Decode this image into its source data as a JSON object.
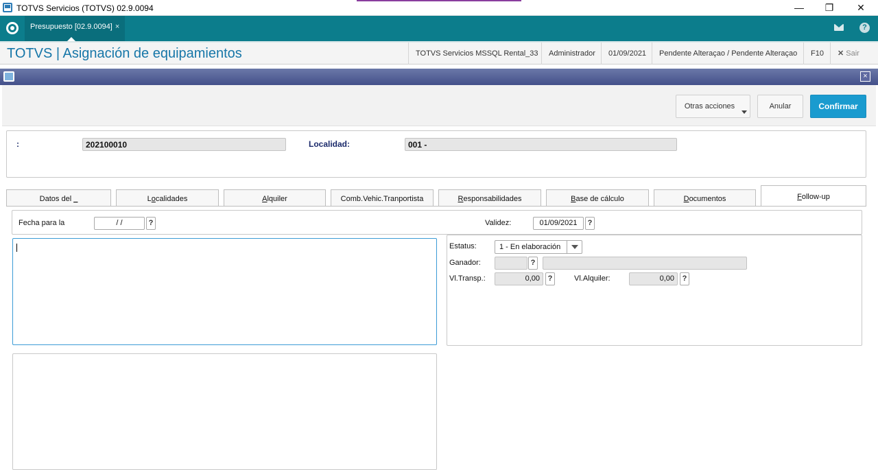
{
  "window": {
    "title": "TOTVS Servicios (TOTVS) 02.9.0094",
    "minimize": "—",
    "restore": "❐",
    "close": "✕"
  },
  "appbar": {
    "tab_label": "Presupuesto [02.9.0094]",
    "tab_close": "×",
    "help": "?"
  },
  "header": {
    "module_title": "TOTVS | Asignación de equipamientos",
    "environment": "TOTVS Servicios MSSQL Rental_33",
    "user": "Administrador",
    "date": "01/09/2021",
    "status": "Pendente Alteraçao / Pendente Alteraçao",
    "shortcut": "F10",
    "exit_icon": "✕",
    "exit_label": "Sair"
  },
  "subwindow": {
    "close": "×"
  },
  "toolbar": {
    "other_actions": "Otras acciones",
    "cancel": "Anular",
    "confirm": "Confirmar"
  },
  "form": {
    "code_label": ":",
    "code_value": "202100010",
    "locality_label": "Localidad:",
    "locality_value": "001 -"
  },
  "tabs": [
    {
      "pre": "Datos del ",
      "u": "_",
      "post": ""
    },
    {
      "pre": "L",
      "u": "o",
      "post": "calidades"
    },
    {
      "pre": "",
      "u": "A",
      "post": "lquiler"
    },
    {
      "pre": "Comb.Vehic.Tranportista",
      "u": "",
      "post": ""
    },
    {
      "pre": "",
      "u": "R",
      "post": "esponsabilidades"
    },
    {
      "pre": "",
      "u": "B",
      "post": "ase de cálculo"
    },
    {
      "pre": "",
      "u": "D",
      "post": "ocumentos"
    },
    {
      "pre": "",
      "u": "F",
      "post": "ollow-up"
    }
  ],
  "followup": {
    "date_label": "Fecha para la",
    "date_value": "/ /",
    "validity_label": "Validez:",
    "validity_value": "01/09/2021",
    "status_label": "Estatus:",
    "status_value": "1 - En elaboración",
    "winner_label": "Ganador:",
    "winner_value": "",
    "winner_name": "",
    "transp_label": "Vl.Transp.:",
    "transp_value": "0,00",
    "rent_label": "Vl.Alquiler:",
    "rent_value": "0,00",
    "lookup": "?"
  }
}
